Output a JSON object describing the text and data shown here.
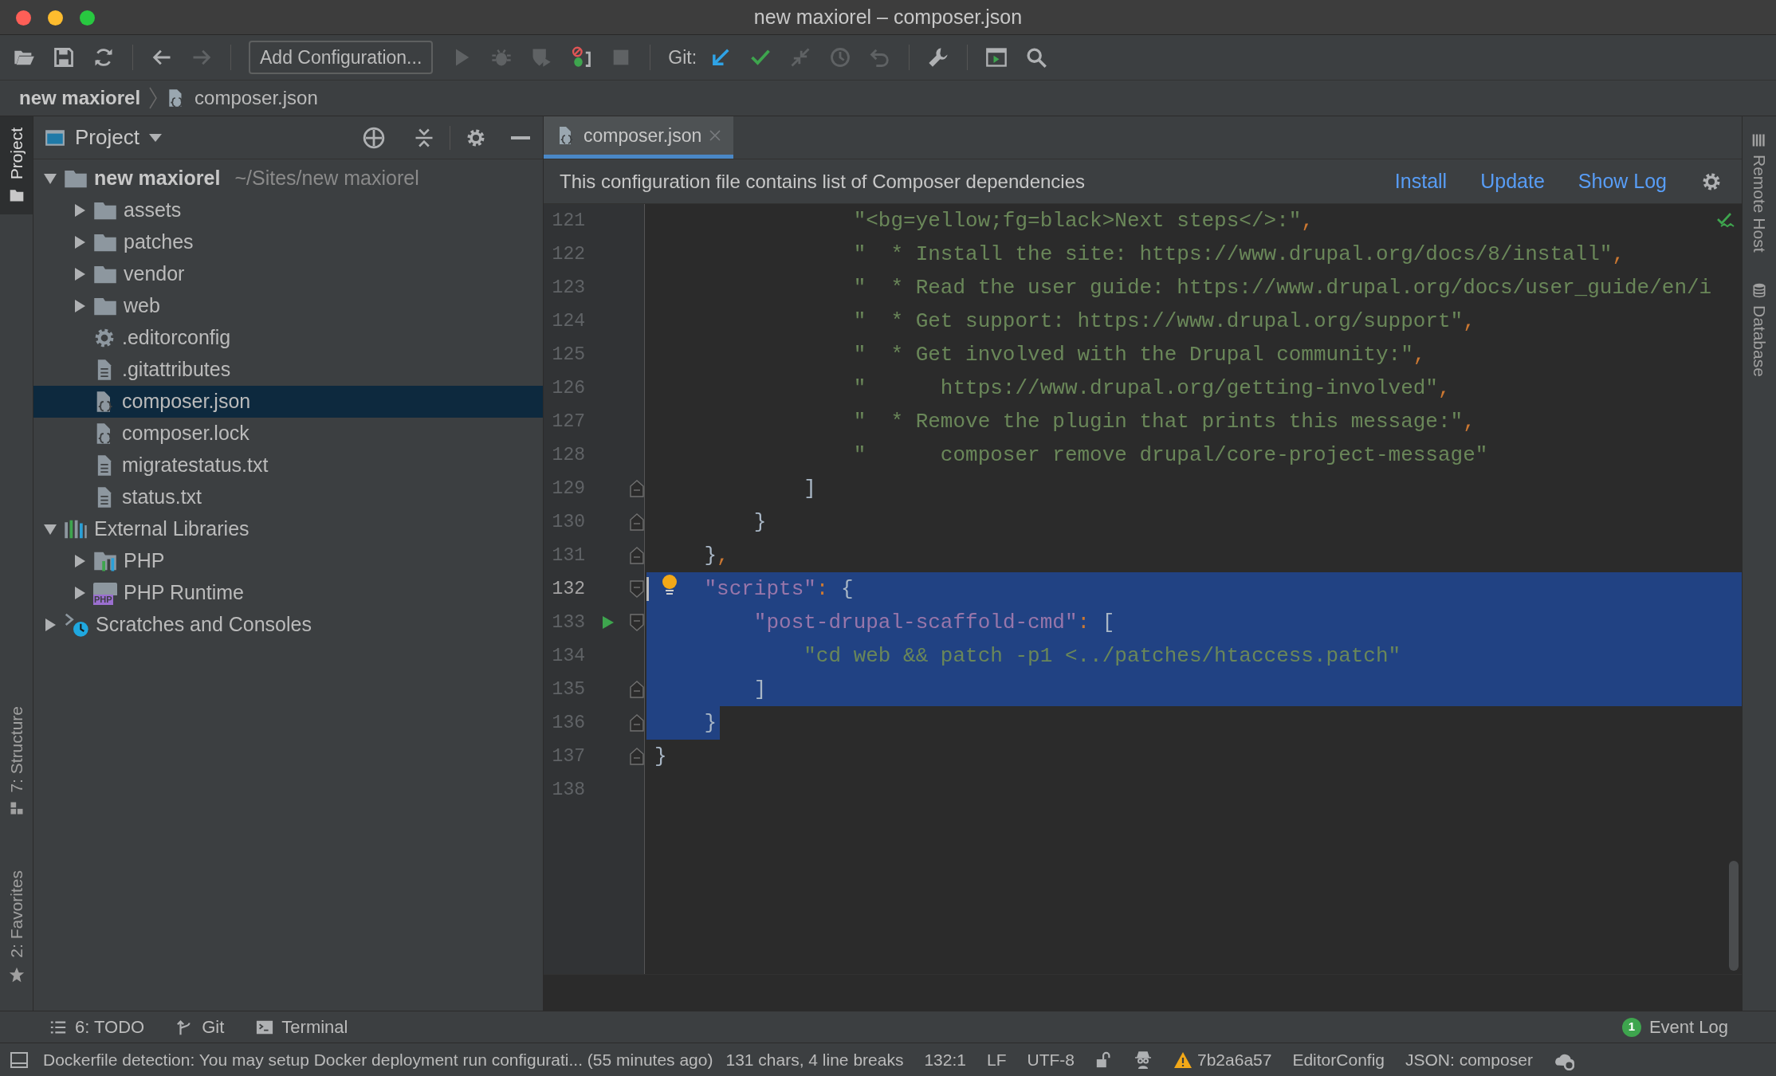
{
  "window": {
    "title": "new maxiorel – composer.json"
  },
  "toolbar": [
    {
      "kind": "icon",
      "disabled": false
    },
    {
      "kind": "icon",
      "disabled": false
    },
    {
      "kind": "icon",
      "disabled": false
    },
    {
      "kind": "separator"
    },
    {
      "kind": "icon",
      "disabled": false
    },
    {
      "kind": "icon",
      "disabled": true
    },
    {
      "kind": "separator"
    },
    {
      "kind": "button",
      "label": "Add Configuration..."
    },
    {
      "kind": "icon",
      "disabled": true
    },
    {
      "kind": "icon",
      "disabled": true
    },
    {
      "kind": "icon",
      "disabled": true
    },
    {
      "kind": "icon",
      "disabled": false
    },
    {
      "kind": "icon",
      "disabled": true
    },
    {
      "kind": "separator"
    },
    {
      "kind": "label",
      "label": "Git:"
    },
    {
      "kind": "icon",
      "disabled": false
    },
    {
      "kind": "icon",
      "disabled": false
    },
    {
      "kind": "icon",
      "disabled": true
    },
    {
      "kind": "icon",
      "disabled": true
    },
    {
      "kind": "icon",
      "disabled": true
    },
    {
      "kind": "separator"
    },
    {
      "kind": "icon",
      "disabled": false
    },
    {
      "kind": "separator"
    },
    {
      "kind": "icon",
      "disabled": false
    },
    {
      "kind": "icon",
      "disabled": false
    }
  ],
  "breadcrumb": [
    {
      "label": "new maxiorel",
      "kind": "project"
    },
    {
      "label": "composer.json",
      "kind": "json"
    }
  ],
  "left_strip": [
    {
      "label": "Project",
      "selected": true
    },
    {
      "label": "7: Structure",
      "selected": false
    },
    {
      "label": "2: Favorites",
      "selected": false
    }
  ],
  "project_panel": {
    "title": "Project",
    "tree": [
      {
        "label": "new maxiorel",
        "path": "~/Sites/new maxiorel",
        "kind": "project",
        "expanded": true,
        "selected": false,
        "children": [
          {
            "label": "assets",
            "kind": "folder",
            "expanded": false,
            "selected": false
          },
          {
            "label": "patches",
            "kind": "folder",
            "expanded": false,
            "selected": false
          },
          {
            "label": "vendor",
            "kind": "folder",
            "expanded": false,
            "selected": false
          },
          {
            "label": "web",
            "kind": "folder",
            "expanded": false,
            "selected": false
          },
          {
            "label": ".editorconfig",
            "kind": "config",
            "selected": false
          },
          {
            "label": ".gitattributes",
            "kind": "text",
            "selected": false
          },
          {
            "label": "composer.json",
            "kind": "json",
            "selected": true
          },
          {
            "label": "composer.lock",
            "kind": "json",
            "selected": false
          },
          {
            "label": "migratestatus.txt",
            "kind": "text",
            "selected": false
          },
          {
            "label": "status.txt",
            "kind": "text",
            "selected": false
          }
        ]
      },
      {
        "label": "External Libraries",
        "kind": "libraries",
        "expanded": true,
        "selected": false,
        "children": [
          {
            "label": "PHP",
            "kind": "php",
            "expanded": false,
            "selected": false
          },
          {
            "label": "PHP Runtime",
            "kind": "php-runtime",
            "badge": "PHP",
            "expanded": false,
            "selected": false
          }
        ]
      },
      {
        "label": "Scratches and Consoles",
        "kind": "scratches",
        "expanded": false,
        "selected": false
      }
    ]
  },
  "editor": {
    "tabs": [
      {
        "label": "composer.json",
        "selected": true
      }
    ],
    "banner": {
      "text": "This configuration file contains list of Composer dependencies",
      "links": [
        "Install",
        "Update",
        "Show Log"
      ]
    },
    "lines": [
      {
        "number": "121",
        "caret": false,
        "fold_start": false,
        "fold_end": false,
        "run_marker": false,
        "intention_bulb": false,
        "selected": false,
        "tokens": [
          {
            "kind": "string",
            "text": "                \"<bg=yellow;fg=black>Next steps</>:\""
          },
          {
            "kind": "punct",
            "text": ","
          }
        ]
      },
      {
        "number": "122",
        "caret": false,
        "fold_start": false,
        "fold_end": false,
        "run_marker": false,
        "intention_bulb": false,
        "selected": false,
        "tokens": [
          {
            "kind": "string",
            "text": "                \"  * Install the site: https://www.drupal.org/docs/8/install\""
          },
          {
            "kind": "punct",
            "text": ","
          }
        ]
      },
      {
        "number": "123",
        "caret": false,
        "fold_start": false,
        "fold_end": false,
        "run_marker": false,
        "intention_bulb": false,
        "selected": false,
        "tokens": [
          {
            "kind": "string",
            "text": "                \"  * Read the user guide: https://www.drupal.org/docs/user_guide/en/i"
          }
        ]
      },
      {
        "number": "124",
        "caret": false,
        "fold_start": false,
        "fold_end": false,
        "run_marker": false,
        "intention_bulb": false,
        "selected": false,
        "tokens": [
          {
            "kind": "string",
            "text": "                \"  * Get support: https://www.drupal.org/support\""
          },
          {
            "kind": "punct",
            "text": ","
          }
        ]
      },
      {
        "number": "125",
        "caret": false,
        "fold_start": false,
        "fold_end": false,
        "run_marker": false,
        "intention_bulb": false,
        "selected": false,
        "tokens": [
          {
            "kind": "string",
            "text": "                \"  * Get involved with the Drupal community:\""
          },
          {
            "kind": "punct",
            "text": ","
          }
        ]
      },
      {
        "number": "126",
        "caret": false,
        "fold_start": false,
        "fold_end": false,
        "run_marker": false,
        "intention_bulb": false,
        "selected": false,
        "tokens": [
          {
            "kind": "string",
            "text": "                \"      https://www.drupal.org/getting-involved\""
          },
          {
            "kind": "punct",
            "text": ","
          }
        ]
      },
      {
        "number": "127",
        "caret": false,
        "fold_start": false,
        "fold_end": false,
        "run_marker": false,
        "intention_bulb": false,
        "selected": false,
        "tokens": [
          {
            "kind": "string",
            "text": "                \"  * Remove the plugin that prints this message:\""
          },
          {
            "kind": "punct",
            "text": ","
          }
        ]
      },
      {
        "number": "128",
        "caret": false,
        "fold_start": false,
        "fold_end": false,
        "run_marker": false,
        "intention_bulb": false,
        "selected": false,
        "tokens": [
          {
            "kind": "string",
            "text": "                \"      composer remove drupal/core-project-message\""
          }
        ]
      },
      {
        "number": "129",
        "caret": false,
        "fold_start": false,
        "fold_end": true,
        "run_marker": false,
        "intention_bulb": false,
        "selected": false,
        "tokens": [
          {
            "kind": "plain",
            "text": "            ]"
          }
        ]
      },
      {
        "number": "130",
        "caret": false,
        "fold_start": false,
        "fold_end": true,
        "run_marker": false,
        "intention_bulb": false,
        "selected": false,
        "tokens": [
          {
            "kind": "plain",
            "text": "        }"
          }
        ]
      },
      {
        "number": "131",
        "caret": false,
        "fold_start": false,
        "fold_end": true,
        "run_marker": false,
        "intention_bulb": false,
        "selected": false,
        "tokens": [
          {
            "kind": "plain",
            "text": "    }"
          },
          {
            "kind": "punct",
            "text": ","
          }
        ]
      },
      {
        "number": "132",
        "caret": true,
        "fold_start": true,
        "fold_end": false,
        "run_marker": false,
        "intention_bulb": true,
        "selected": true,
        "selected_to_line_end": true,
        "tokens": [
          {
            "kind": "key",
            "text": "    \"scripts\""
          },
          {
            "kind": "punct",
            "text": ": "
          },
          {
            "kind": "plain",
            "text": "{"
          }
        ]
      },
      {
        "number": "133",
        "caret": false,
        "fold_start": true,
        "fold_end": false,
        "run_marker": true,
        "intention_bulb": false,
        "selected": true,
        "selected_to_line_end": true,
        "tokens": [
          {
            "kind": "key",
            "text": "        \"post-drupal-scaffold-cmd\""
          },
          {
            "kind": "punct",
            "text": ": "
          },
          {
            "kind": "plain",
            "text": "["
          }
        ]
      },
      {
        "number": "134",
        "caret": false,
        "fold_start": false,
        "fold_end": false,
        "run_marker": false,
        "intention_bulb": false,
        "selected": true,
        "selected_to_line_end": true,
        "tokens": [
          {
            "kind": "string",
            "text": "            \"cd web && patch -p1 <../patches/htaccess.patch\""
          }
        ]
      },
      {
        "number": "135",
        "caret": false,
        "fold_start": false,
        "fold_end": true,
        "run_marker": false,
        "intention_bulb": false,
        "selected": true,
        "selected_to_line_end": true,
        "tokens": [
          {
            "kind": "plain",
            "text": "        ]"
          }
        ]
      },
      {
        "number": "136",
        "caret": false,
        "fold_start": false,
        "fold_end": true,
        "run_marker": false,
        "intention_bulb": false,
        "selected": true,
        "selected_to_line_end": false,
        "tokens": [
          {
            "kind": "plain",
            "text": "    }"
          }
        ]
      },
      {
        "number": "137",
        "caret": false,
        "fold_start": false,
        "fold_end": true,
        "run_marker": false,
        "intention_bulb": false,
        "selected": false,
        "tokens": [
          {
            "kind": "plain",
            "text": "}"
          }
        ]
      },
      {
        "number": "138",
        "caret": false,
        "fold_start": false,
        "fold_end": false,
        "run_marker": false,
        "intention_bulb": false,
        "selected": false
      }
    ]
  },
  "right_strip": [
    {
      "label": "Remote Host",
      "selected": false
    },
    {
      "label": "Database",
      "selected": false
    }
  ],
  "tool_tabs": [
    {
      "label": "6: TODO"
    },
    {
      "label": "Git"
    },
    {
      "label": "Terminal"
    }
  ],
  "event_log": {
    "label": "Event Log",
    "count": "1"
  },
  "status_bar": {
    "message": "Dockerfile detection: You may setup Docker deployment run configurati... (55 minutes ago)",
    "items": [
      {
        "kind": "text",
        "text": "131 chars, 4 line breaks"
      },
      {
        "kind": "text",
        "text": "132:1"
      },
      {
        "kind": "text",
        "text": "LF"
      },
      {
        "kind": "text",
        "text": "UTF-8"
      },
      {
        "kind": "icon"
      },
      {
        "kind": "icon"
      },
      {
        "kind": "warning",
        "text": "7b2a6a57"
      },
      {
        "kind": "text",
        "text": "EditorConfig"
      },
      {
        "kind": "text",
        "text": "JSON: composer"
      },
      {
        "kind": "icon"
      }
    ]
  }
}
